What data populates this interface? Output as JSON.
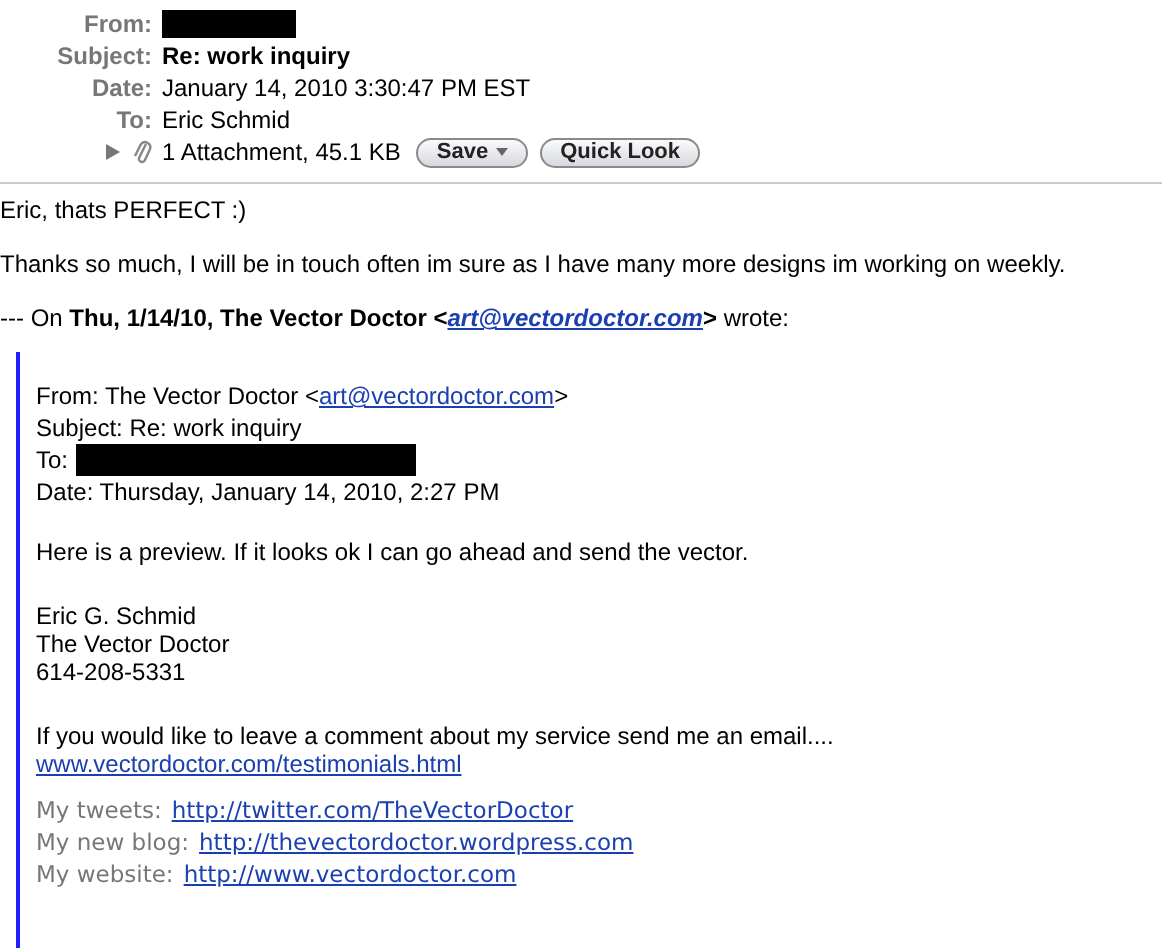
{
  "header": {
    "fields": [
      {
        "label": "From:",
        "kind": "redacted"
      },
      {
        "label": "Subject:",
        "value": "Re: work inquiry",
        "kind": "bold"
      },
      {
        "label": "Date:",
        "value": "January 14, 2010 3:30:47 PM EST",
        "kind": "plain"
      },
      {
        "label": "To:",
        "value": "Eric Schmid",
        "kind": "plain"
      }
    ],
    "attachment": {
      "expanded": false,
      "summary": "1 Attachment, 45.1 KB",
      "buttons": [
        {
          "label": "Save",
          "menu": true
        },
        {
          "label": "Quick Look",
          "menu": false
        }
      ]
    }
  },
  "body": [
    "Eric, thats PERFECT :)",
    "Thanks so much, I will be in touch often im sure as I have many more designs im working on weekly."
  ],
  "quote_intro": {
    "before": "--- On **Thu, 1/14/10, The Vector Doctor <**",
    "link": "art@vectordoctor.com",
    "after": "**>** wrote:"
  },
  "quote": {
    "from": {
      "before": "From: The Vector Doctor <",
      "link": "art@vectordoctor.com",
      "after": ">"
    },
    "subject": "Subject: Re: work inquiry",
    "to_label": "To:",
    "date": "Date: Thursday, January 14, 2010, 2:27 PM",
    "message": "Here is a preview. If it looks ok I can go ahead and send the vector.",
    "signature": [
      "Eric G. Schmid",
      "The Vector Doctor",
      "614-208-5331"
    ],
    "comment": "If you would like to leave a comment about my service send me an email....",
    "comment_link": "www.vectordoctor.com/testimonials.html",
    "links": [
      {
        "label": "My tweets:",
        "url": "http://twitter.com/TheVectorDoctor"
      },
      {
        "label": "My new blog:",
        "url": "http://thevectordoctor.wordpress.com"
      },
      {
        "label": "My website:",
        "url": "http://www.vectordoctor.com"
      }
    ]
  }
}
